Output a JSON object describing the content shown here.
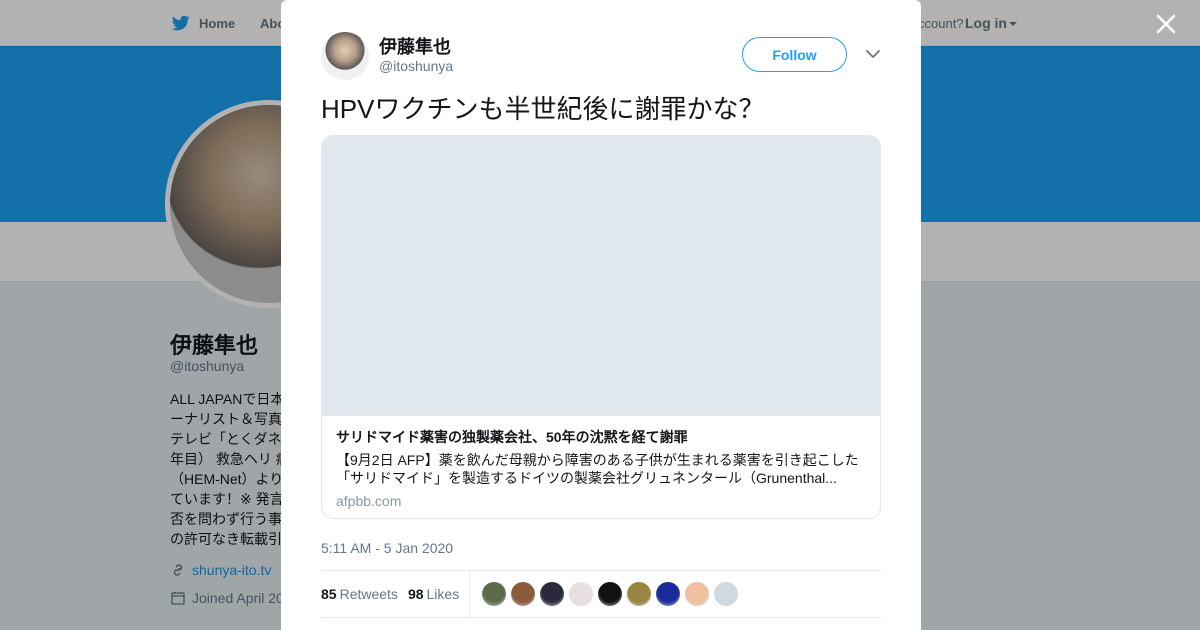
{
  "topnav": {
    "home_label": "Home",
    "about_label": "Abo",
    "account_prompt": "ccount?",
    "login_label": "Log in"
  },
  "profile": {
    "name": "伊藤隼也",
    "handle": "@itoshunya",
    "bio_lines": [
      "ALL JAPANで日本",
      "ーナリスト＆写真",
      "テレビ「とくダネ",
      "年目） 救急ヘリ 病",
      "（HEM-Net）より",
      "ています！※ 発言",
      "否を問わず行う事",
      "の許可なき転載引"
    ],
    "website": "shunya-ito.tv",
    "joined": "Joined April 20"
  },
  "tweet": {
    "author_name": "伊藤隼也",
    "author_handle": "@itoshunya",
    "follow_label": "Follow",
    "text": "HPVワクチンも半世紀後に謝罪かな？",
    "card": {
      "title": "サリドマイド薬害の独製薬会社、50年の沈黙を経て謝罪",
      "description_lines": [
        "【9月2日 AFP】薬を飲んだ母親から障害のある子供が生まれる薬害を引き起こした",
        "「サリドマイド」を製造するドイツの製薬会社グリュネンタール（Grunenthal..."
      ],
      "domain": "afpbb.com"
    },
    "timestamp": "5:11 AM - 5 Jan 2020",
    "retweets_count": "85",
    "retweets_label": "Retweets",
    "likes_count": "98",
    "likes_label": "Likes",
    "likers": [
      {
        "color": "#5b6b4a"
      },
      {
        "color": "#8a5a3a"
      },
      {
        "color": "#2a2a3a"
      },
      {
        "color": "#e8e0e0"
      },
      {
        "color": "#111111"
      },
      {
        "color": "#9a8540"
      },
      {
        "color": "#1a2a9a"
      },
      {
        "color": "#f0c0a0"
      },
      {
        "color": "#d0d8e0"
      }
    ]
  },
  "colors": {
    "accent": "#1da1f2",
    "banner": "#1da1f2"
  }
}
